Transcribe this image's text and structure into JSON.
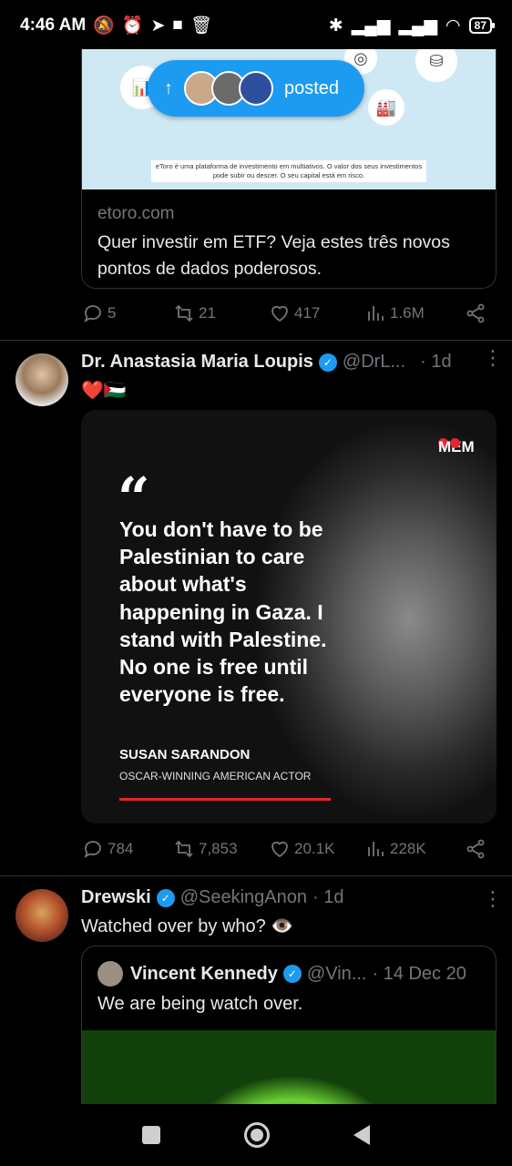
{
  "status_bar": {
    "time": "4:46 AM",
    "battery": "87"
  },
  "card1": {
    "disclaimer": "eToro é uma plataforma de investimento em multiativos. O valor dos seus investimentos pode subir ou descer. O seu capital está em risco.",
    "domain": "etoro.com",
    "title": "Quer investir em ETF? Veja estes três novos pontos de dados poderosos."
  },
  "posted_pill": {
    "label": "posted"
  },
  "tweet1_actions": {
    "replies": "5",
    "retweets": "21",
    "likes": "417",
    "views": "1.6M"
  },
  "tweet2": {
    "name": "Dr. Anastasia Maria Loupis",
    "handle": "@DrL...",
    "time": "· 1d",
    "text": "❤️🇵🇸",
    "image": {
      "brand": "MEM",
      "quote": "You don't have to be Palestinian to care about what's happening in Gaza. I stand with Palestine. No one is free until everyone is free.",
      "author": "SUSAN SARANDON",
      "role": "OSCAR-WINNING AMERICAN ACTOR"
    },
    "actions": {
      "replies": "784",
      "retweets": "7,853",
      "likes": "20.1K",
      "views": "228K"
    }
  },
  "tweet3": {
    "name": "Drewski",
    "handle": "@SeekingAnon",
    "time": "· 1d",
    "text": "Watched over by who? 👁️",
    "quoted": {
      "name": "Vincent Kennedy",
      "handle": "@Vin...",
      "time": "· 14 Dec 20",
      "text": "We are being watch over."
    }
  },
  "colors": {
    "accent": "#1d9bf0",
    "muted": "#71767b",
    "text": "#e7e9ea",
    "border": "#2f3336",
    "memo_red": "#e3262f"
  }
}
